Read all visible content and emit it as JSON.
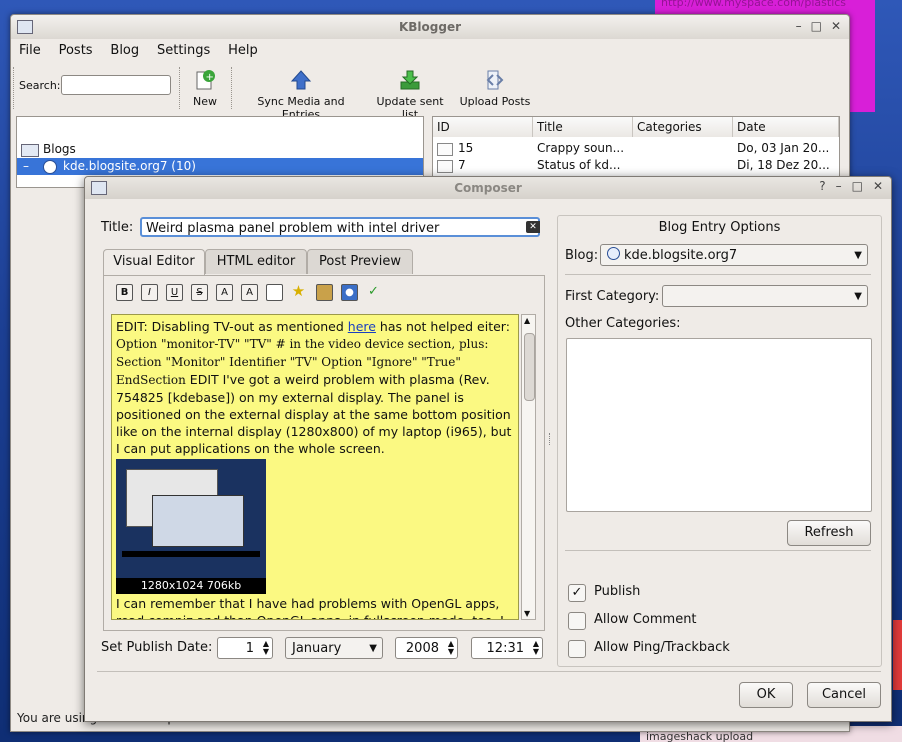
{
  "desktop": {
    "magenta_text": "http://www.myspace.com/plastics",
    "bottom_right_text": "imageshack upload"
  },
  "main_window": {
    "title": "KBlogger",
    "menu": [
      "File",
      "Posts",
      "Blog",
      "Settings",
      "Help"
    ],
    "search_label": "Search:",
    "search_value": "",
    "toolbar": {
      "new_label": "New",
      "sync_label": "Sync Media and Entries",
      "update_label": "Update sent list",
      "upload_label": "Upload Posts"
    },
    "tree": {
      "root_label": "Blogs",
      "selected_blog": "kde.blogsite.org7 (10)"
    },
    "posts_table": {
      "columns": [
        "ID",
        "Title",
        "Categories",
        "Date"
      ],
      "rows": [
        {
          "id": "15",
          "title": "Crappy soun...",
          "categories": "",
          "date": "Do, 03 Jan 20..."
        },
        {
          "id": "7",
          "title": "Status of kd...",
          "categories": "",
          "date": "Di, 18 Dez 20..."
        }
      ]
    },
    "status_text": "You are using ... for Wordpress API"
  },
  "composer": {
    "title": "Composer",
    "title_label": "Title:",
    "title_value": "Weird plasma panel problem with intel driver",
    "tabs": [
      "Visual Editor",
      "HTML editor",
      "Post Preview"
    ],
    "format_buttons": [
      "B",
      "I",
      "U",
      "S",
      "A",
      "A"
    ],
    "editor": {
      "line1_pre": "EDIT: Disabling TV-out as mentioned ",
      "link_text": "here",
      "line1_post": " has not helped eiter: ",
      "mono_text": "Option \"monitor-TV\" \"TV\" # in the video device section, plus: Section \"Monitor\" Identifier \"TV\" Option \"Ignore\" \"True\" EndSection",
      "body_text": " EDIT I've got a weird problem with plasma (Rev. 754825 [kdebase]) on my external display. The panel is positioned on the external display at the same bottom position like on the internal display (1280x800) of my laptop (i965), but I can put applications on the whole screen.",
      "image_caption": "1280x1024 706kb",
      "after_text": "I can remember that I have had problems with OpenGL apps, read compiz and than OpenGL apps, in fullscreen mode, too. I"
    },
    "publish_date": {
      "label": "Set Publish Date:",
      "day": "1",
      "month": "January",
      "year": "2008",
      "time": "12:31"
    },
    "options": {
      "group_title": "Blog Entry Options",
      "blog_label": "Blog:",
      "blog_value": "kde.blogsite.org7",
      "first_category_label": "First Category:",
      "first_category_value": "",
      "other_categories_label": "Other Categories:",
      "refresh_label": "Refresh",
      "publish_label": "Publish",
      "publish_checked": true,
      "allow_comment_label": "Allow Comment",
      "allow_comment_checked": false,
      "allow_ping_label": "Allow Ping/Trackback",
      "allow_ping_checked": false
    },
    "ok_label": "OK",
    "cancel_label": "Cancel"
  }
}
